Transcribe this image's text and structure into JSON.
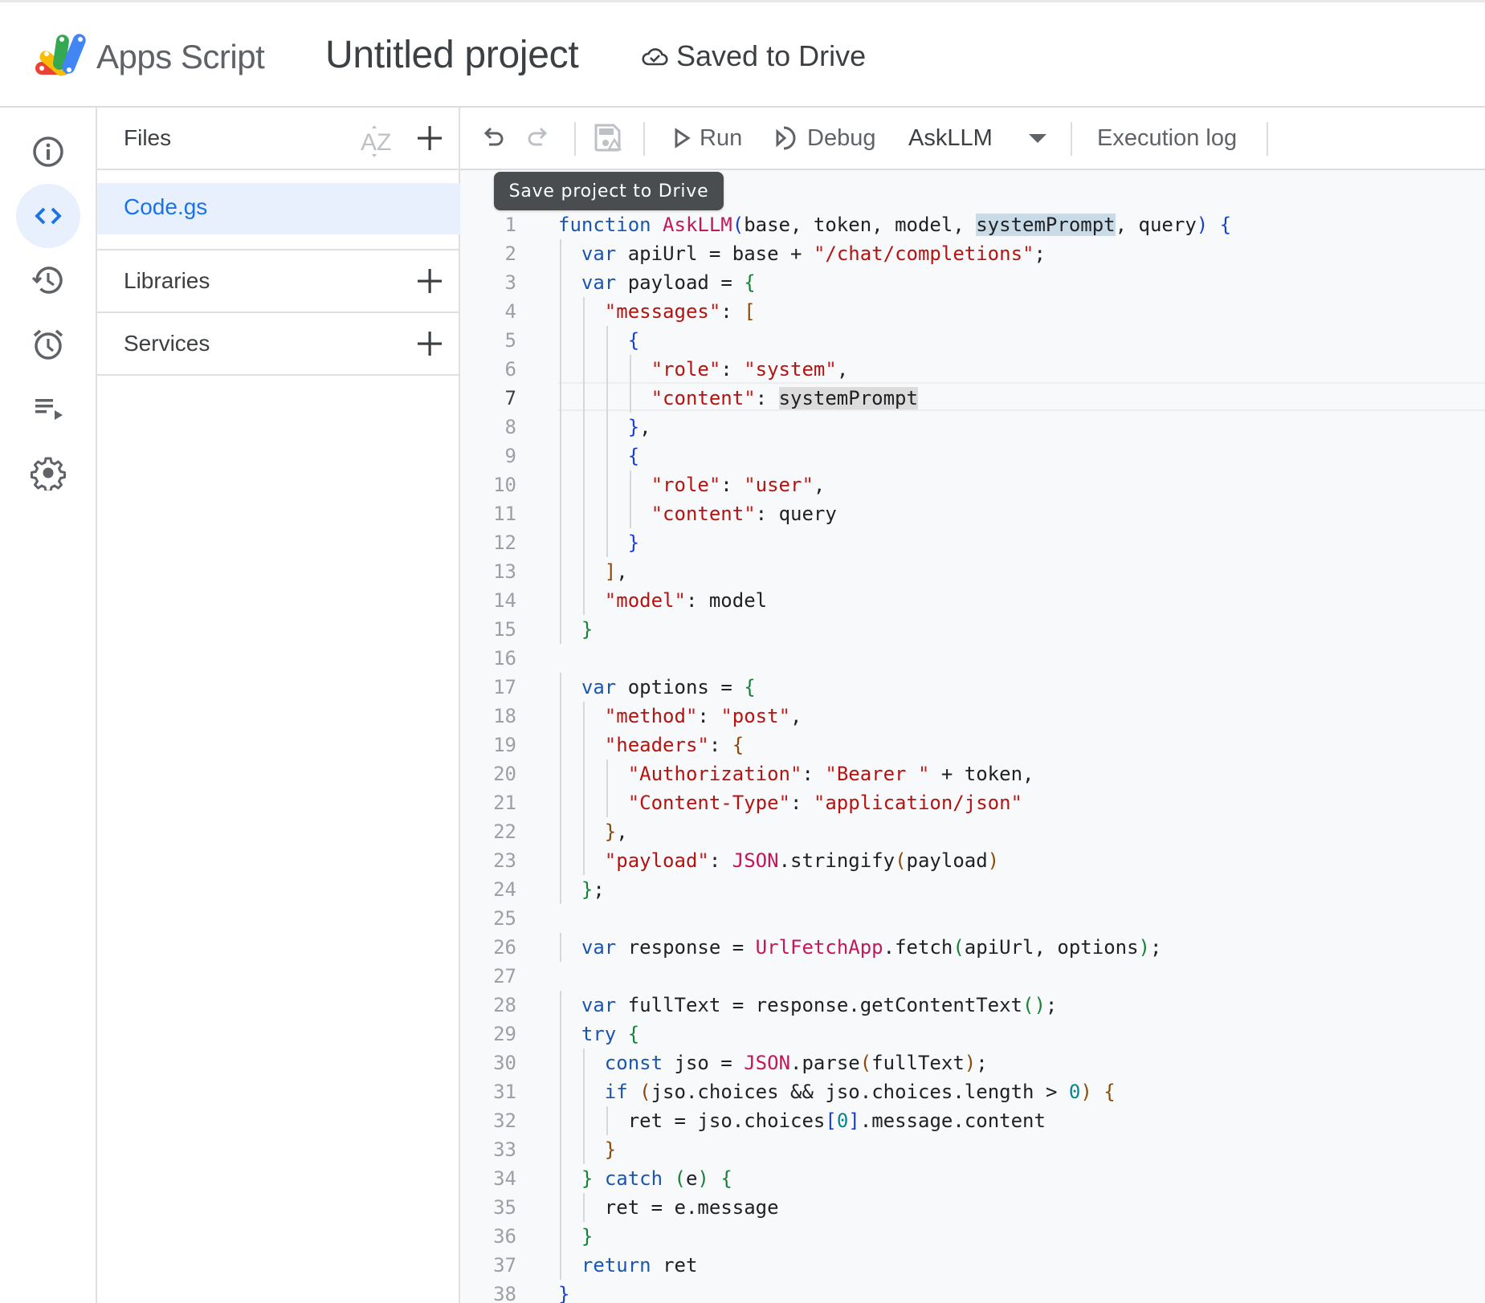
{
  "header": {
    "app_name": "Apps Script",
    "project_title": "Untitled project",
    "save_status": "Saved to Drive"
  },
  "rail": {
    "items": [
      {
        "name": "overview",
        "icon": "info-icon",
        "active": false
      },
      {
        "name": "editor",
        "icon": "code-icon",
        "active": true
      },
      {
        "name": "project-history",
        "icon": "history-icon",
        "active": false
      },
      {
        "name": "triggers",
        "icon": "alarm-icon",
        "active": false
      },
      {
        "name": "executions",
        "icon": "playlist-play-icon",
        "active": false
      },
      {
        "name": "project-settings",
        "icon": "gear-icon",
        "active": false
      }
    ]
  },
  "files_panel": {
    "files_title": "Files",
    "sort_icon": "sort-az-icon",
    "files": [
      {
        "name": "Code.gs",
        "selected": true
      }
    ],
    "libraries_title": "Libraries",
    "services_title": "Services"
  },
  "toolbar": {
    "undo": "undo-icon",
    "redo": "redo-icon",
    "save": "save-to-drive-icon",
    "run_label": "Run",
    "debug_label": "Debug",
    "function_selected": "AskLLM",
    "execution_log_label": "Execution log",
    "tooltip": "Save project to Drive"
  },
  "editor": {
    "current_line": 7,
    "lines": [
      "function AskLLM(base, token, model, systemPrompt, query) {",
      "  var apiUrl = base + \"/chat/completions\";",
      "  var payload = {",
      "    \"messages\": [",
      "      {",
      "        \"role\": \"system\",",
      "        \"content\": systemPrompt",
      "      },",
      "      {",
      "        \"role\": \"user\",",
      "        \"content\": query",
      "      }",
      "    ],",
      "    \"model\": model",
      "  }",
      "",
      "  var options = {",
      "    \"method\": \"post\",",
      "    \"headers\": {",
      "      \"Authorization\": \"Bearer \" + token,",
      "      \"Content-Type\": \"application/json\"",
      "    },",
      "    \"payload\": JSON.stringify(payload)",
      "  };",
      "",
      "  var response = UrlFetchApp.fetch(apiUrl, options);",
      "",
      "  var fullText = response.getContentText();",
      "  try {",
      "    const jso = JSON.parse(fullText);",
      "    if (jso.choices && jso.choices.length > 0) {",
      "      ret = jso.choices[0].message.content",
      "    }",
      "  } catch (e) {",
      "    ret = e.message",
      "  }",
      "  return ret",
      "}"
    ]
  }
}
